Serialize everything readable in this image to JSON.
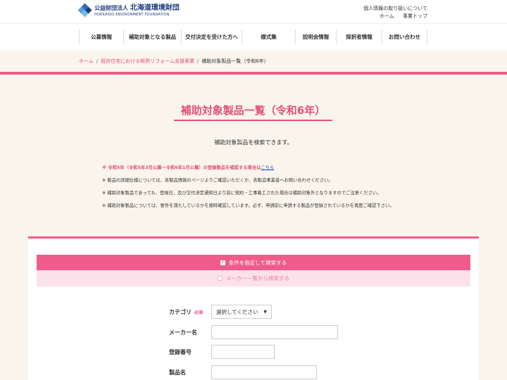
{
  "header": {
    "logo_prefix": "公益財団法人",
    "logo_name": "北海道環境財団",
    "logo_sub": "HOKKAIDO ENVIRONMENT FOUNDATION",
    "privacy_link": "個人情報の取り扱いについて",
    "home_link": "ホーム",
    "project_top_link": "事業トップ"
  },
  "nav": [
    {
      "label": "公募情報"
    },
    {
      "label": "補助対象となる製品"
    },
    {
      "label": "交付決定を受けた方へ"
    },
    {
      "label": "様式集"
    },
    {
      "label": "説明会情報"
    },
    {
      "label": "採択者情報"
    },
    {
      "label": "お問い合わせ"
    }
  ],
  "breadcrumb": {
    "home": "ホーム",
    "project": "既存住宅における断熱リフォーム支援事業",
    "current": "補助対象製品一覧（令和6年）",
    "separator": "/"
  },
  "page": {
    "title": "補助対象製品一覧（令和6年）",
    "subtitle": "補助対象製品を検索できます。"
  },
  "notes": [
    {
      "text": "※ 令和5年（令和5年3月公募～令和6年1月公募）の登録製品を確認する場合は",
      "link": "こちら"
    },
    {
      "text": "※ 製品の詳細仕様については、各製品情報のページよりご確認いただくか、各製造事業者へお問い合わせください。"
    },
    {
      "text": "※ 補助対象製品であっても、登録日、及び交付決定通知日より前に契約・工事着工された場合は補助対象外となりますのでご注意ください。"
    },
    {
      "text": "※ 補助対象製品については、要件を満たしているかを随時確認しています。必ず、申請前に申請する製品が登録されているかを再度ご確認下さい。"
    }
  ],
  "search": {
    "tab_condition": "条件を指定して検索する",
    "tab_maker_list": "メーカー一覧から検索する",
    "category_label": "カテゴリ",
    "required_mark": "必須",
    "category_value": "選択してください",
    "maker_label": "メーカー名",
    "reg_number_label": "登録番号",
    "product_label": "製品名"
  },
  "colors": {
    "accent": "#ef5b8a",
    "accent_text": "#e4507a",
    "background": "#faf5ec",
    "tab_inactive": "#fbe1ea",
    "link": "#1a4fd0"
  }
}
